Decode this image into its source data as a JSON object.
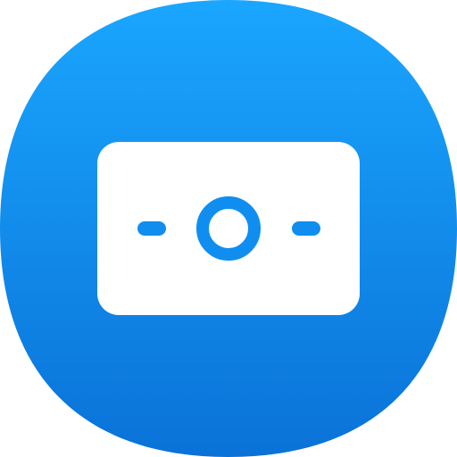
{
  "app_icon": {
    "name": "money-app-icon",
    "glyph": "banknote-icon",
    "colors": {
      "gradient_top": "#1aa6ff",
      "gradient_bottom": "#0a72d8",
      "glyph_fill": "#ffffff",
      "glyph_detail": "#0f8ef0"
    }
  }
}
